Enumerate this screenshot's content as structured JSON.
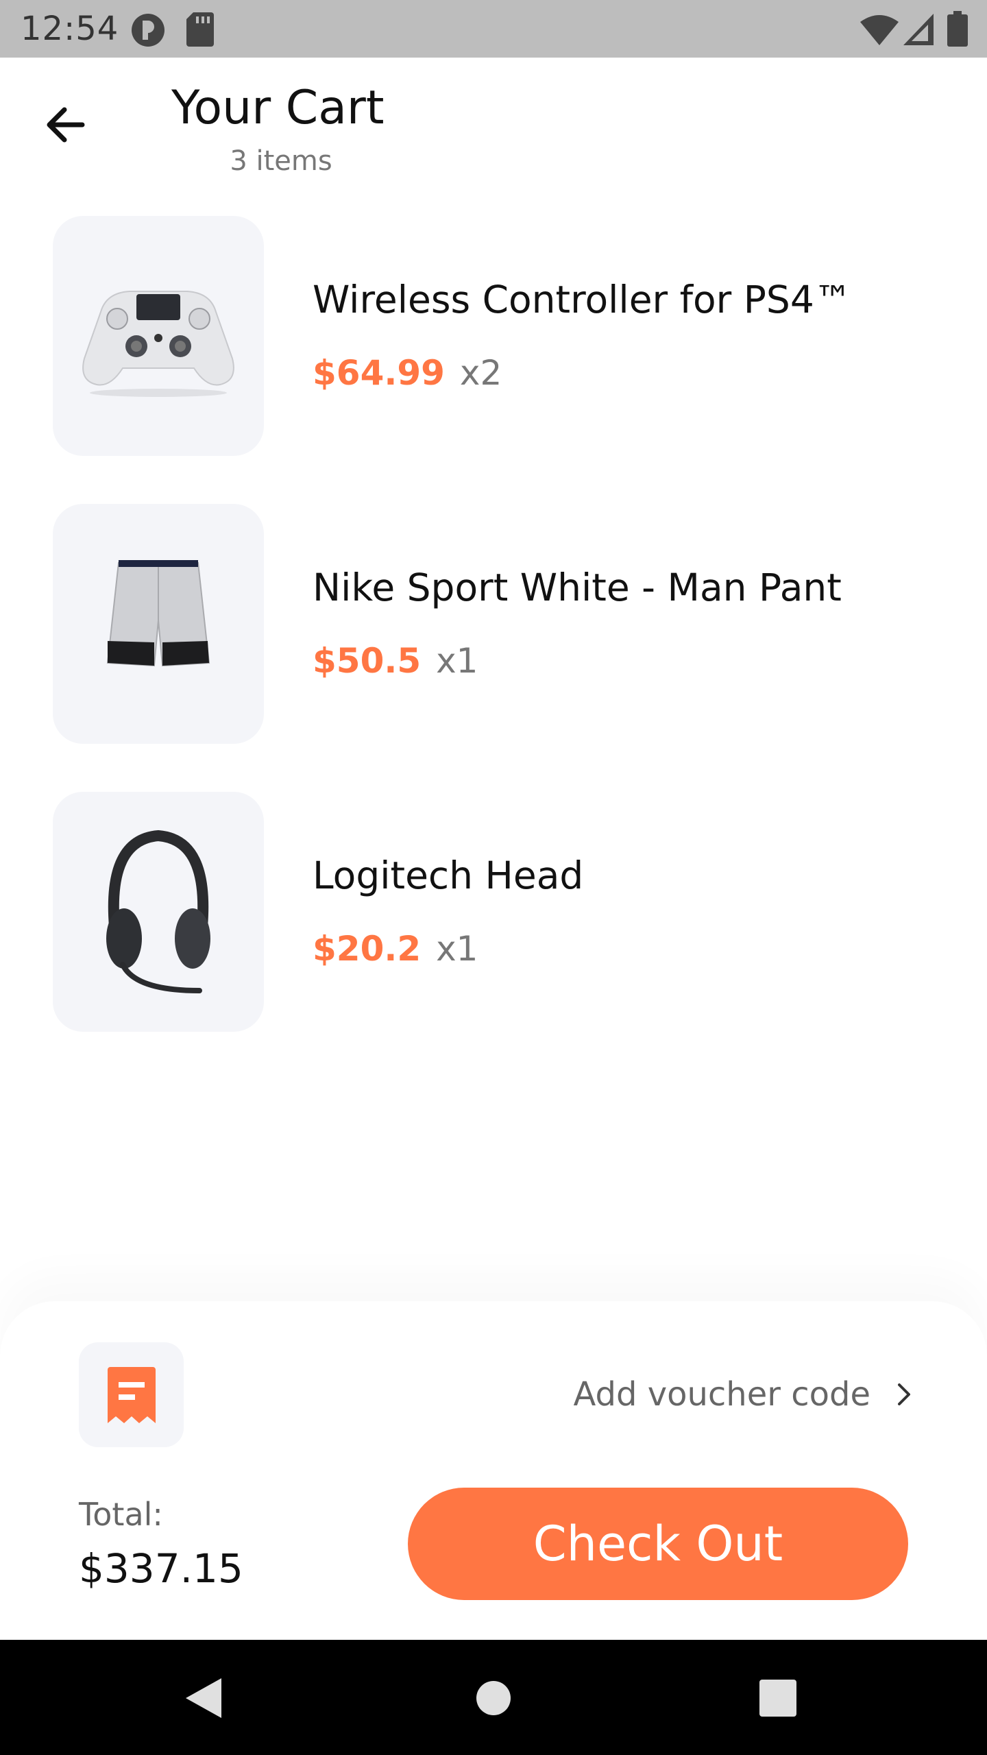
{
  "status_bar": {
    "time": "12:54",
    "icons": [
      "notification-app-icon",
      "sd-card-icon",
      "wifi-icon",
      "signal-icon",
      "battery-icon"
    ]
  },
  "header": {
    "back_icon": "arrow-left-icon",
    "title": "Your Cart",
    "subtitle": "3 items"
  },
  "cart": {
    "items": [
      {
        "name": "Wireless Controller for PS4™",
        "price": "$64.99",
        "qty": "x2",
        "image": "game-controller-image"
      },
      {
        "name": "Nike Sport White - Man Pant",
        "price": "$50.5",
        "qty": "x1",
        "image": "shorts-image"
      },
      {
        "name": "Logitech Head",
        "price": "$20.2",
        "qty": "x1",
        "image": "headset-image"
      }
    ]
  },
  "checkout": {
    "voucher_icon": "receipt-icon",
    "voucher_label": "Add voucher code",
    "voucher_chevron": "chevron-right-icon",
    "total_label": "Total:",
    "total_value": "$337.15",
    "button_label": "Check Out"
  },
  "nav_bar": {
    "buttons": [
      "back-triangle-icon",
      "home-circle-icon",
      "recents-square-icon"
    ]
  },
  "colors": {
    "accent": "#ff7643",
    "thumb_bg": "#f4f5f9",
    "status_bar": "#bdbdbd",
    "nav_bar": "#000000"
  }
}
